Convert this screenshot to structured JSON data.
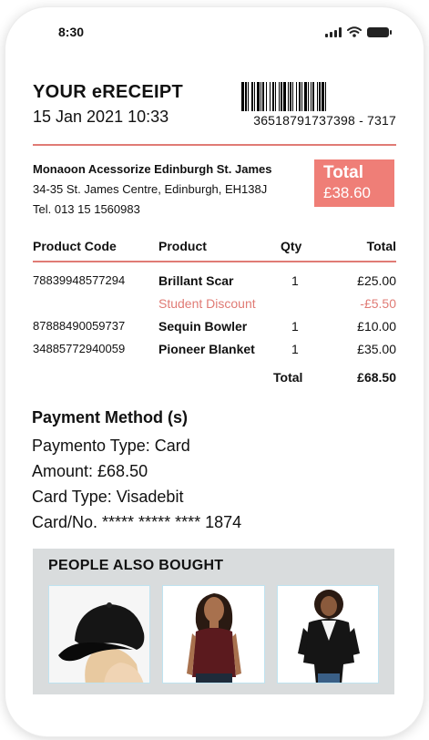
{
  "statusbar": {
    "time": "8:30"
  },
  "receipt": {
    "title": "YOUR eRECEIPT",
    "datetime": "15 Jan 2021  10:33",
    "barcode_number": "36518791737398 - 7317"
  },
  "store": {
    "name": "Monaoon Acessorize Edinburgh St. James",
    "address": "34-35 St. James Centre, Edinburgh, EH138J",
    "phone": "Tel. 013 15 1560983"
  },
  "total_box": {
    "label": "Total",
    "amount": "£38.60"
  },
  "table": {
    "headers": {
      "code": "Product Code",
      "product": "Product",
      "qty": "Qty",
      "total": "Total"
    },
    "rows": [
      {
        "code": "78839948577294",
        "product": "Brillant Scar",
        "qty": "1",
        "total": "£25.00"
      },
      {
        "code": "",
        "product": "Student Discount",
        "qty": "",
        "total": "-£5.50"
      },
      {
        "code": "87888490059737",
        "product": "Sequin Bowler",
        "qty": "1",
        "total": "£10.00"
      },
      {
        "code": "34885772940059",
        "product": "Pioneer Blanket",
        "qty": "1",
        "total": "£35.00"
      }
    ],
    "grand_label": "Total",
    "grand_value": "£68.50"
  },
  "payment": {
    "title": "Payment Method (s)",
    "type": "Paymento Type: Card",
    "amount": "Amount: £68.50",
    "card_type": "Card Type: Visadebit",
    "card_no": "Card/No. ***** ***** **** 1874"
  },
  "also_bought": {
    "title": "PEOPLE ALSO BOUGHT"
  },
  "colors": {
    "accent": "#ef7e77",
    "rule": "#e07b75",
    "panel": "#d9dcdd"
  }
}
